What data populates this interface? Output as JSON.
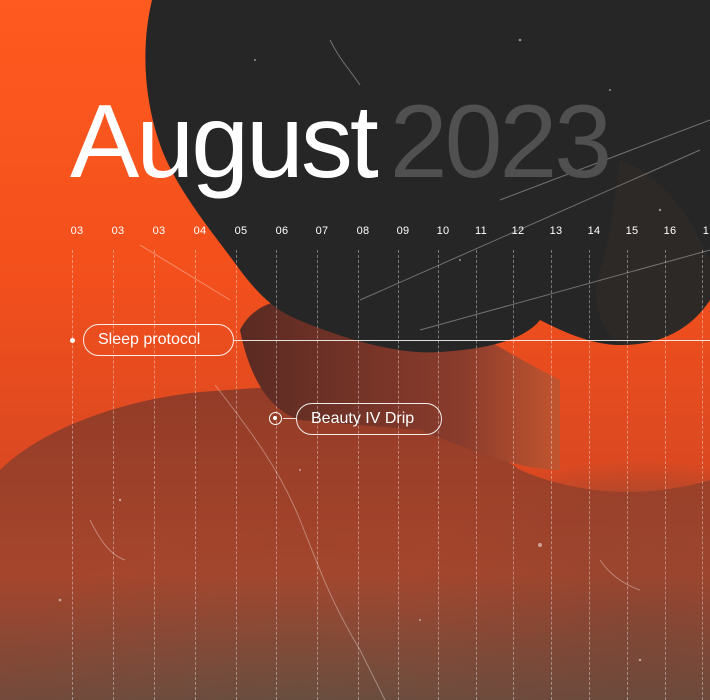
{
  "header": {
    "month": "August",
    "year": "2023"
  },
  "timeline": {
    "days": [
      "03",
      "03",
      "03",
      "04",
      "05",
      "06",
      "07",
      "08",
      "09",
      "10",
      "11",
      "12",
      "13",
      "14",
      "15",
      "16",
      "1"
    ]
  },
  "events": {
    "sleep_label": "Sleep protocol",
    "beauty_label": "Beauty IV Drip"
  },
  "colors": {
    "background_orange": "#ff5a1f",
    "silhouette": "#262626",
    "year_text": "#505050",
    "text": "#ffffff"
  }
}
